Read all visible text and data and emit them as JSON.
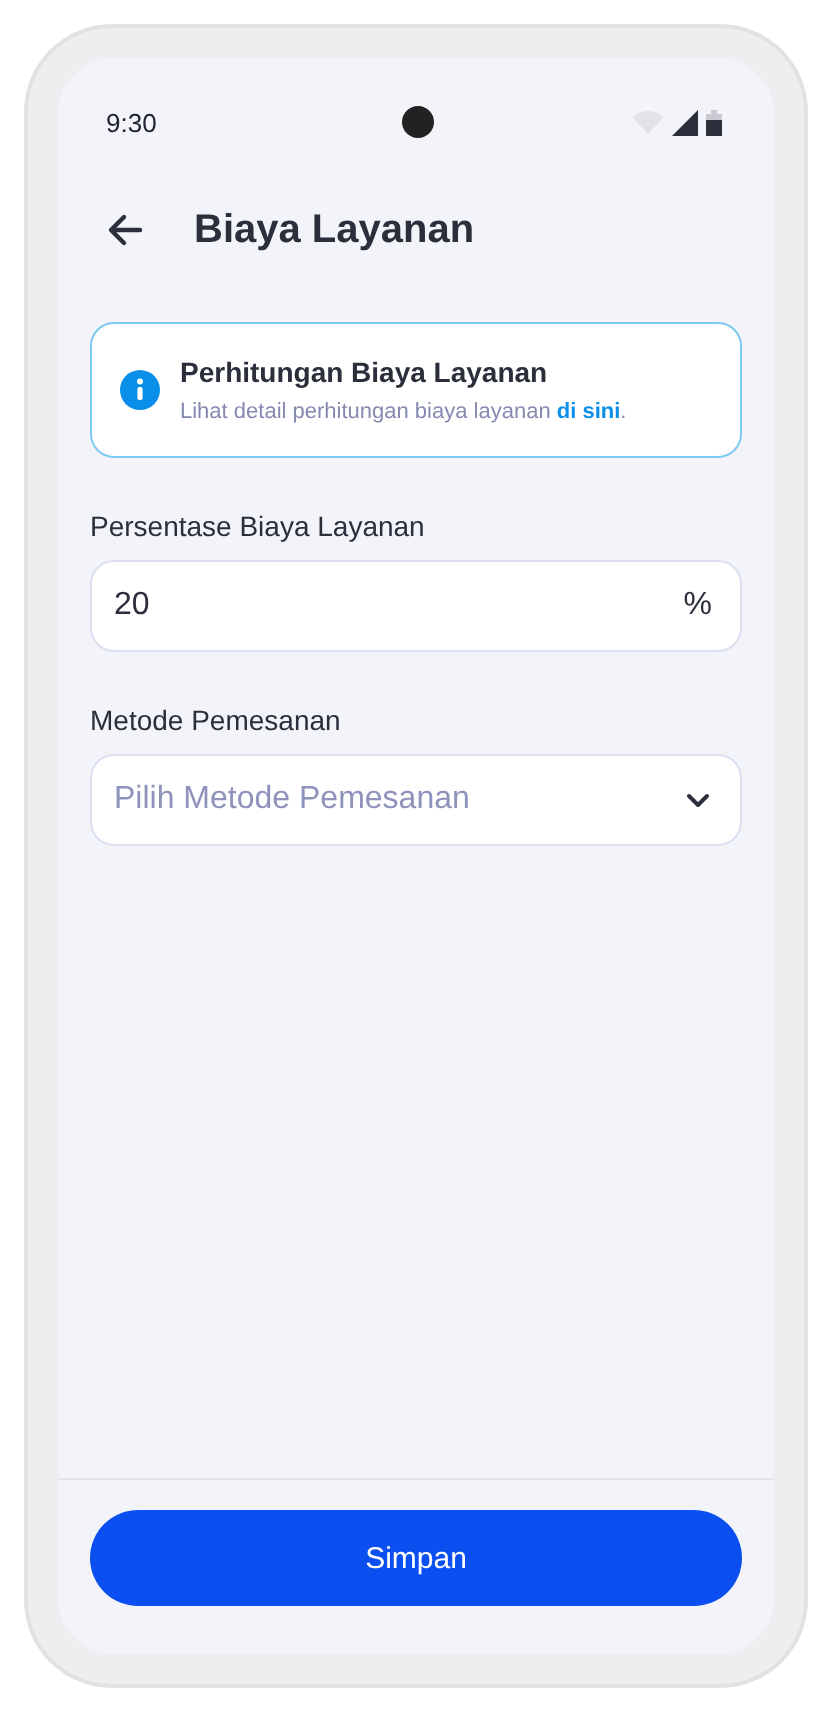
{
  "status_bar": {
    "time": "9:30"
  },
  "header": {
    "title": "Biaya Layanan"
  },
  "info_card": {
    "title": "Perhitungan Biaya Layanan",
    "text": "Lihat detail perhitungan biaya layanan ",
    "link": "di sini",
    "suffix": "."
  },
  "fields": [
    {
      "kind": "input",
      "label": "Persentase Biaya Layanan",
      "value": "20",
      "suffix": "%"
    },
    {
      "kind": "select",
      "label": "Metode Pemesanan",
      "placeholder": "Pilih Metode Pemesanan"
    }
  ],
  "footer": {
    "button": "Simpan"
  }
}
